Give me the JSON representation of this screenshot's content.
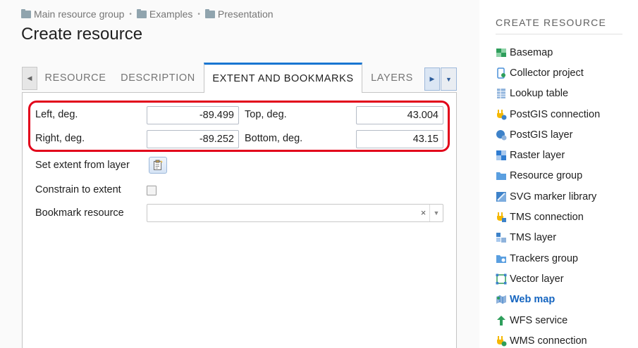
{
  "breadcrumb": [
    {
      "label": "Main resource group"
    },
    {
      "label": "Examples"
    },
    {
      "label": "Presentation"
    }
  ],
  "page_title": "Create resource",
  "tabs": [
    {
      "label": "RESOURCE"
    },
    {
      "label": "DESCRIPTION"
    },
    {
      "label": "EXTENT AND BOOKMARKS",
      "active": true
    },
    {
      "label": "LAYERS"
    }
  ],
  "form": {
    "left_label": "Left, deg.",
    "left_value": "-89.499",
    "top_label": "Top, deg.",
    "top_value": "43.004",
    "right_label": "Right, deg.",
    "right_value": "-89.252",
    "bottom_label": "Bottom, deg.",
    "bottom_value": "43.15",
    "set_extent_label": "Set extent from layer",
    "constrain_label": "Constrain to extent",
    "constrain_checked": false,
    "bookmark_label": "Bookmark resource",
    "bookmark_value": "",
    "clear_glyph": "×"
  },
  "sidebar": {
    "title": "CREATE RESOURCE",
    "items": [
      {
        "label": "Basemap",
        "icon": "basemap-icon",
        "color": "#2e9e5b"
      },
      {
        "label": "Collector project",
        "icon": "collector-project-icon",
        "color": "#4a90d9"
      },
      {
        "label": "Lookup table",
        "icon": "lookup-table-icon",
        "color": "#8fb3dc"
      },
      {
        "label": "PostGIS connection",
        "icon": "postgis-connection-icon",
        "color": "#f5b800"
      },
      {
        "label": "PostGIS layer",
        "icon": "postgis-layer-icon",
        "color": "#3d82c9"
      },
      {
        "label": "Raster layer",
        "icon": "raster-layer-icon",
        "color": "#2f7cd1"
      },
      {
        "label": "Resource group",
        "icon": "resource-group-icon",
        "color": "#5a9fe0"
      },
      {
        "label": "SVG marker library",
        "icon": "svg-marker-library-icon",
        "color": "#3d82c9"
      },
      {
        "label": "TMS connection",
        "icon": "tms-connection-icon",
        "color": "#f5b800"
      },
      {
        "label": "TMS layer",
        "icon": "tms-layer-icon",
        "color": "#3d82c9"
      },
      {
        "label": "Trackers group",
        "icon": "trackers-group-icon",
        "color": "#5a9fe0"
      },
      {
        "label": "Vector layer",
        "icon": "vector-layer-icon",
        "color": "#2e9e5b"
      },
      {
        "label": "Web map",
        "icon": "web-map-icon",
        "color": "#3d82c9",
        "highlighted": true
      },
      {
        "label": "WFS service",
        "icon": "wfs-service-icon",
        "color": "#2e9e5b"
      },
      {
        "label": "WMS connection",
        "icon": "wms-connection-icon",
        "color": "#f5b800"
      }
    ]
  }
}
